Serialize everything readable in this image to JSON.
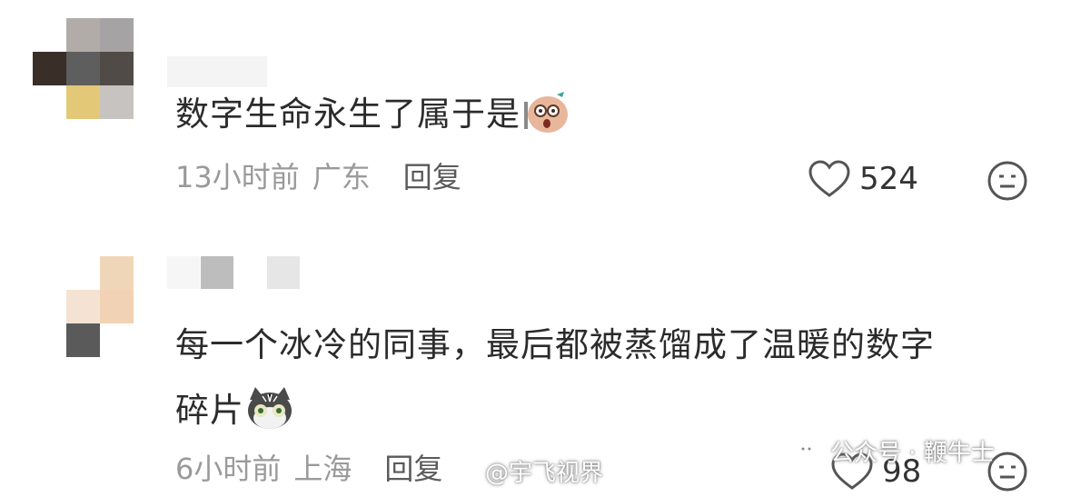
{
  "comments": [
    {
      "text": "数字生命永生了属于是",
      "emoji": "shocked-sticker-emoji",
      "time": "13小时前",
      "location": "广东",
      "reply_label": "回复",
      "likes": "524"
    },
    {
      "text_line1": "每一个冰冷的同事，最后都被蒸馏成了温暖的数字",
      "text_line2": "碎片",
      "emoji": "cat-sticker-emoji",
      "time": "6小时前",
      "location": "上海",
      "reply_label": "回复",
      "likes": "98"
    }
  ],
  "watermarks": {
    "weibo": "@宇飞视界",
    "wechat": "公众号 · 鞭牛士"
  },
  "colors": {
    "text": "#2b2b2b",
    "meta": "#9a9a9a",
    "icon": "#555555"
  }
}
